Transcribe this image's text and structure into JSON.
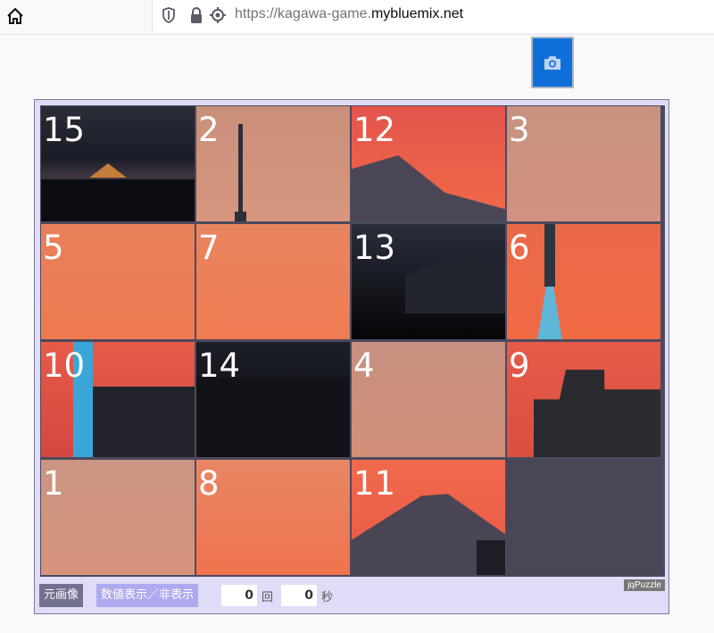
{
  "browser": {
    "url_prefix": "https://kagawa-game.",
    "url_domain": "mybluemix.net"
  },
  "camera_button": {
    "icon": "camera-icon"
  },
  "puzzle": {
    "tiles": [
      {
        "label": "15",
        "row": 0,
        "col": 0
      },
      {
        "label": "2",
        "row": 0,
        "col": 1
      },
      {
        "label": "12",
        "row": 0,
        "col": 2
      },
      {
        "label": "3",
        "row": 0,
        "col": 3
      },
      {
        "label": "5",
        "row": 1,
        "col": 0
      },
      {
        "label": "7",
        "row": 1,
        "col": 1
      },
      {
        "label": "13",
        "row": 1,
        "col": 2
      },
      {
        "label": "6",
        "row": 1,
        "col": 3
      },
      {
        "label": "10",
        "row": 2,
        "col": 0
      },
      {
        "label": "14",
        "row": 2,
        "col": 1
      },
      {
        "label": "4",
        "row": 2,
        "col": 2
      },
      {
        "label": "9",
        "row": 2,
        "col": 3
      },
      {
        "label": "1",
        "row": 3,
        "col": 0
      },
      {
        "label": "8",
        "row": 3,
        "col": 1
      },
      {
        "label": "11",
        "row": 3,
        "col": 2
      }
    ],
    "empty": {
      "row": 3,
      "col": 3
    },
    "watermark": "jqPuzzle"
  },
  "controls": {
    "original_image_label": "元画像",
    "toggle_numbers_label": "数値表示／非表示",
    "moves_value": "0",
    "moves_unit": "回",
    "seconds_value": "0",
    "seconds_unit": "秒"
  }
}
